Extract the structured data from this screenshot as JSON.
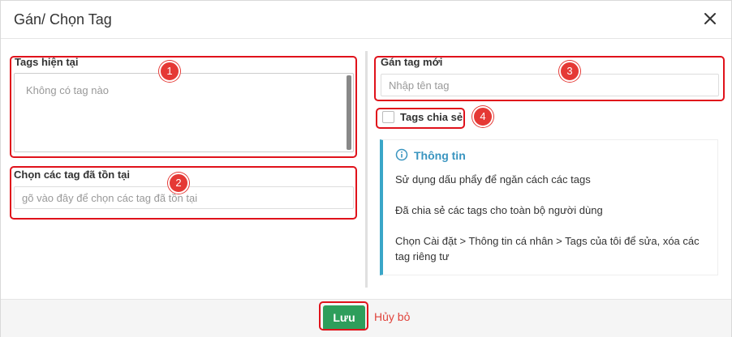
{
  "dialog": {
    "title": "Gán/ Chọn Tag",
    "close_icon": "close-icon"
  },
  "left": {
    "current_tags_label": "Tags hiện tại",
    "current_tags_placeholder": "Không có tag nào",
    "choose_existing_label": "Chọn các tag đã tồn tại",
    "choose_existing_placeholder": "gõ vào đây để chọn các tag đã tồn tại"
  },
  "right": {
    "new_tag_label": "Gán tag mới",
    "new_tag_placeholder": "Nhập tên tag",
    "share_checkbox_label": "Tags chia sẻ",
    "share_checked": false,
    "info": {
      "title": "Thông tin",
      "lines": [
        "Sử dụng dấu phẩy để ngăn cách các tags",
        "Đã chia sẻ các tags cho toàn bộ người dùng",
        "Chọn Cài đặt > Thông tin cá nhân > Tags của tôi để sửa, xóa các tag riêng tư"
      ]
    }
  },
  "annotations": [
    "1",
    "2",
    "3",
    "4"
  ],
  "footer": {
    "save_label": "Lưu",
    "cancel_label": "Hủy bỏ"
  },
  "colors": {
    "save_button": "#2e9e5b",
    "cancel_text": "#e0443c",
    "info_accent": "#3aa6c8",
    "annotation_red": "#e0121b"
  }
}
